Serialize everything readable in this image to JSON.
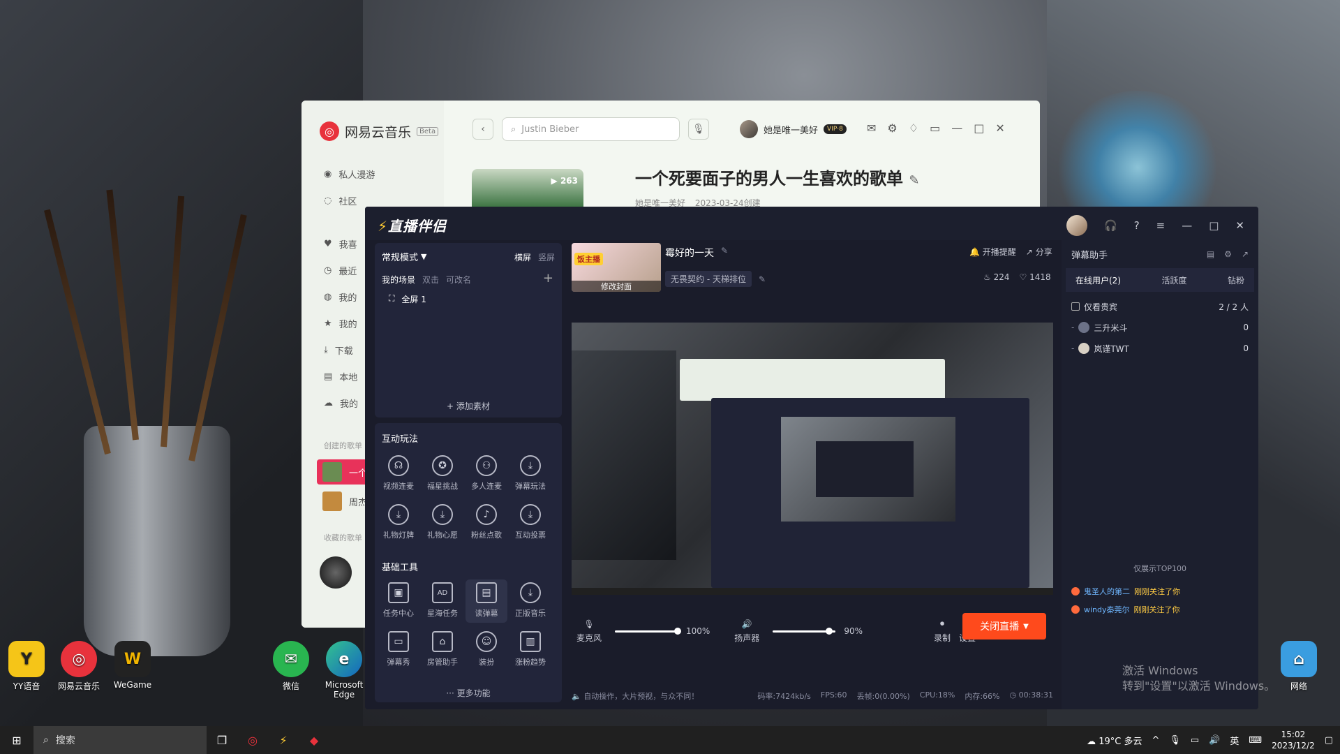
{
  "desktop": {
    "icons": [
      {
        "label": "YY语音",
        "icon": "yy-icon"
      },
      {
        "label": "网易云音乐",
        "icon": "netease-music-icon"
      },
      {
        "label": "WeGame",
        "icon": "wegame-icon"
      },
      {
        "label": "微信",
        "icon": "wechat-icon"
      },
      {
        "label": "Microsoft Edge",
        "icon": "edge-icon"
      },
      {
        "label": "网络",
        "icon": "network-icon"
      }
    ]
  },
  "netease": {
    "app_name": "网易云音乐",
    "beta": "Beta",
    "search_placeholder": "Justin Bieber",
    "user_name": "她是唯一美好",
    "vip_badge": "VIP·8",
    "nav": [
      "私人漫游",
      "社区",
      "我喜",
      "最近",
      "我的",
      "我的",
      "下载",
      "本地",
      "我的"
    ],
    "created_section": "创建的歌单",
    "collected_section": "收藏的歌单",
    "playlist_items": [
      "一个 人",
      "周杰"
    ],
    "playlist": {
      "title": "一个死要面子的男人一生喜欢的歌单",
      "creator": "她是唯一美好",
      "date": "2023-03-24创建",
      "plays": "263"
    }
  },
  "live": {
    "app_name": "直播伴侣",
    "mode": "常规模式",
    "orientation": [
      "横屏",
      "竖屏"
    ],
    "scene_header": "我的场景",
    "scene_hint_dbl": "双击",
    "scene_hint_rename": "可改名",
    "scene_item": "全屏 1",
    "add_material": "添加素材",
    "interactive_title": "互动玩法",
    "interactive_tools": [
      "视频连麦",
      "福星挑战",
      "多人连麦",
      "弹幕玩法",
      "礼物灯牌",
      "礼物心愿",
      "粉丝点歌",
      "互动投票"
    ],
    "basic_title": "基础工具",
    "basic_tools": [
      "任务中心",
      "星海任务",
      "读弹幕",
      "正版音乐",
      "弹幕秀",
      "房管助手",
      "装扮",
      "涨粉趋势"
    ],
    "more": "更多功能",
    "cover_tag": "饭主播",
    "cover_edit": "修改封面",
    "room_title": "霉好的一天",
    "category": "无畏契约 - 天梯排位",
    "remind": "开播提醒",
    "share": "分享",
    "fire_count": "224",
    "like_count": "1418",
    "mic_label": "麦克风",
    "mic_pct": "100%",
    "spk_label": "扬声器",
    "spk_pct": "90%",
    "mic_level": 1.0,
    "spk_level": 0.9,
    "record": "录制",
    "settings": "设置",
    "stop_btn": "关闭直播",
    "status_tip": "自动操作，大片预视，与众不同！",
    "bitrate": "码率:7424kb/s",
    "fps": "FPS:60",
    "drop": "丢帧:0(0.00%)",
    "cpu": "CPU:18%",
    "mem": "内存:66%",
    "duration": "00:38:31"
  },
  "danmu": {
    "title": "弹幕助手",
    "tabs": [
      "在线用户(2)",
      "活跃度",
      "钻粉"
    ],
    "only_vip": "仅看贵宾",
    "count": "2 / 2 人",
    "users": [
      {
        "name": "三升米斗",
        "score": "0"
      },
      {
        "name": "岚谨TWT",
        "score": "0"
      }
    ],
    "top_label": "仅展示TOP100",
    "gifts": [
      {
        "user": "鬼圣人的第二",
        "msg": "刚刚关注了你"
      },
      {
        "user": "windy秦莞尔",
        "msg": "刚刚关注了你"
      }
    ]
  },
  "watermark": [
    "激活 Windows",
    "转到\"设置\"以激活 Windows。"
  ],
  "taskbar": {
    "search": "搜索",
    "weather": "19°C 多云",
    "ime": "英",
    "time": "15:02",
    "date": "2023/12/2"
  }
}
